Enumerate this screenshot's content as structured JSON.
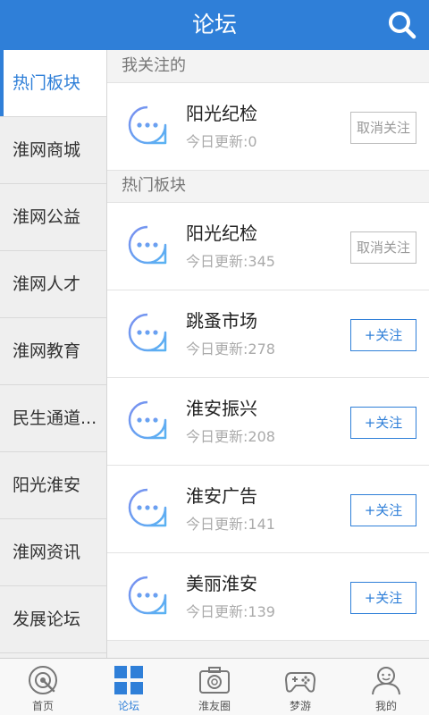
{
  "header": {
    "title": "论坛",
    "search_icon": "search-icon"
  },
  "sidebar": {
    "items": [
      {
        "label": "热门板块",
        "active": true
      },
      {
        "label": "淮网商城"
      },
      {
        "label": "淮网公益"
      },
      {
        "label": "淮网人才"
      },
      {
        "label": "淮网教育"
      },
      {
        "label": "民生通道..."
      },
      {
        "label": "阳光淮安"
      },
      {
        "label": "淮网资讯"
      },
      {
        "label": "发展论坛"
      }
    ]
  },
  "main": {
    "following_title": "我关注的",
    "following": [
      {
        "name": "阳光纪检",
        "updates": "今日更新:0",
        "action": "取消关注"
      }
    ],
    "hot_title": "热门板块",
    "hot": [
      {
        "name": "阳光纪检",
        "updates": "今日更新:345",
        "action": "取消关注"
      },
      {
        "name": "跳蚤市场",
        "updates": "今日更新:278",
        "action": "+关注"
      },
      {
        "name": "淮安振兴",
        "updates": "今日更新:208",
        "action": "+关注"
      },
      {
        "name": "淮安广告",
        "updates": "今日更新:141",
        "action": "+关注"
      },
      {
        "name": "美丽淮安",
        "updates": "今日更新:139",
        "action": "+关注"
      }
    ]
  },
  "tabbar": {
    "tabs": [
      {
        "label": "首页",
        "icon": "home-icon"
      },
      {
        "label": "论坛",
        "icon": "grid-icon",
        "active": true
      },
      {
        "label": "淮友圈",
        "icon": "camera-icon"
      },
      {
        "label": "梦游",
        "icon": "gamepad-icon"
      },
      {
        "label": "我的",
        "icon": "user-icon"
      }
    ]
  },
  "colors": {
    "accent": "#2f7fd8",
    "icon_gradient_start": "#7b8ff0",
    "icon_gradient_end": "#59b2f2"
  }
}
